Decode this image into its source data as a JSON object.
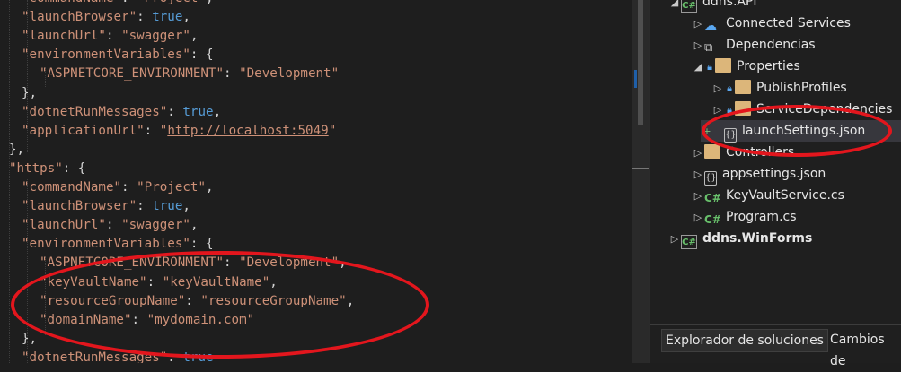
{
  "editor": {
    "lines": [
      {
        "parts": [
          [
            "k",
            "\"commandName\""
          ],
          [
            "p",
            ": "
          ],
          [
            "s",
            "\"Project\""
          ],
          [
            "p",
            ","
          ]
        ]
      },
      {
        "parts": [
          [
            "k",
            "\"launchBrowser\""
          ],
          [
            "p",
            ": "
          ],
          [
            "b",
            "true"
          ],
          [
            "p",
            ","
          ]
        ]
      },
      {
        "parts": [
          [
            "k",
            "\"launchUrl\""
          ],
          [
            "p",
            ": "
          ],
          [
            "s",
            "\"swagger\""
          ],
          [
            "p",
            ","
          ]
        ]
      },
      {
        "parts": [
          [
            "k",
            "\"environmentVariables\""
          ],
          [
            "p",
            ": {"
          ]
        ]
      },
      {
        "parts": [
          [
            "k",
            "\"ASPNETCORE_ENVIRONMENT\""
          ],
          [
            "p",
            ": "
          ],
          [
            "s",
            "\"Development\""
          ]
        ]
      },
      {
        "parts": [
          [
            "p",
            "},"
          ]
        ]
      },
      {
        "parts": [
          [
            "k",
            "\"dotnetRunMessages\""
          ],
          [
            "p",
            ": "
          ],
          [
            "b",
            "true"
          ],
          [
            "p",
            ","
          ]
        ]
      },
      {
        "parts": [
          [
            "k",
            "\"applicationUrl\""
          ],
          [
            "p",
            ": "
          ],
          [
            "s",
            "\""
          ],
          [
            "u",
            "http://localhost:5049"
          ],
          [
            "s",
            "\""
          ]
        ]
      },
      {
        "parts": [
          [
            "p",
            "},"
          ]
        ]
      },
      {
        "parts": [
          [
            "k",
            "\"https\""
          ],
          [
            "p",
            ": {"
          ]
        ]
      },
      {
        "parts": [
          [
            "k",
            "\"commandName\""
          ],
          [
            "p",
            ": "
          ],
          [
            "s",
            "\"Project\""
          ],
          [
            "p",
            ","
          ]
        ]
      },
      {
        "parts": [
          [
            "k",
            "\"launchBrowser\""
          ],
          [
            "p",
            ": "
          ],
          [
            "b",
            "true"
          ],
          [
            "p",
            ","
          ]
        ]
      },
      {
        "parts": [
          [
            "k",
            "\"launchUrl\""
          ],
          [
            "p",
            ": "
          ],
          [
            "s",
            "\"swagger\""
          ],
          [
            "p",
            ","
          ]
        ]
      },
      {
        "parts": [
          [
            "k",
            "\"environmentVariables\""
          ],
          [
            "p",
            ": {"
          ]
        ]
      },
      {
        "parts": [
          [
            "k",
            "\"ASPNETCORE_ENVIRONMENT\""
          ],
          [
            "p",
            ": "
          ],
          [
            "s",
            "\"Development\""
          ],
          [
            "p",
            ","
          ]
        ]
      },
      {
        "parts": [
          [
            "k",
            "\"keyVaultName\""
          ],
          [
            "p",
            ": "
          ],
          [
            "s",
            "\"keyVaultName\""
          ],
          [
            "p",
            ","
          ]
        ]
      },
      {
        "parts": [
          [
            "k",
            "\"resourceGroupName\""
          ],
          [
            "p",
            ": "
          ],
          [
            "s",
            "\"resourceGroupName\""
          ],
          [
            "p",
            ","
          ]
        ]
      },
      {
        "parts": [
          [
            "k",
            "\"domainName\""
          ],
          [
            "p",
            ": "
          ],
          [
            "s",
            "\"mydomain.com\""
          ]
        ]
      },
      {
        "parts": [
          [
            "p",
            "},"
          ]
        ]
      },
      {
        "parts": [
          [
            "k",
            "\"dotnetRunMessages\""
          ],
          [
            "p",
            ": "
          ],
          [
            "b",
            "true"
          ]
        ]
      }
    ]
  },
  "solution_explorer": {
    "items": [
      {
        "label": "ddns.API",
        "icon": "csharp-project-icon",
        "expander": "expanded",
        "lock": false
      },
      {
        "label": "Connected Services",
        "icon": "connected-services-icon",
        "expander": "collapsed",
        "lock": false
      },
      {
        "label": "Dependencias",
        "icon": "dependencies-icon",
        "expander": "collapsed",
        "lock": false
      },
      {
        "label": "Properties",
        "icon": "properties-folder-icon",
        "expander": "expanded",
        "lock": true
      },
      {
        "label": "PublishProfiles",
        "icon": "folder-icon",
        "expander": "collapsed",
        "lock": true
      },
      {
        "label": "ServiceDependencies",
        "icon": "folder-icon",
        "expander": "collapsed",
        "lock": true
      },
      {
        "label": "launchSettings.json",
        "icon": "json-file-icon",
        "expander": "none",
        "lock": false,
        "selected": true,
        "added": true
      },
      {
        "label": "Controllers",
        "icon": "folder-icon",
        "expander": "collapsed",
        "lock": false
      },
      {
        "label": "appsettings.json",
        "icon": "json-file-icon",
        "expander": "collapsed",
        "lock": false
      },
      {
        "label": "KeyVaultService.cs",
        "icon": "csharp-file-icon",
        "expander": "collapsed",
        "lock": false
      },
      {
        "label": "Program.cs",
        "icon": "csharp-file-icon",
        "expander": "collapsed",
        "lock": false
      },
      {
        "label": "ddns.WinForms",
        "icon": "csharp-project-icon",
        "expander": "collapsed",
        "lock": false,
        "bold": true
      }
    ],
    "tabs": [
      {
        "label": "Explorador de soluciones",
        "active": true
      },
      {
        "label": "Cambios de"
      }
    ]
  },
  "colors": {
    "annotation": "#e3161d",
    "accent": "#569cd6"
  }
}
